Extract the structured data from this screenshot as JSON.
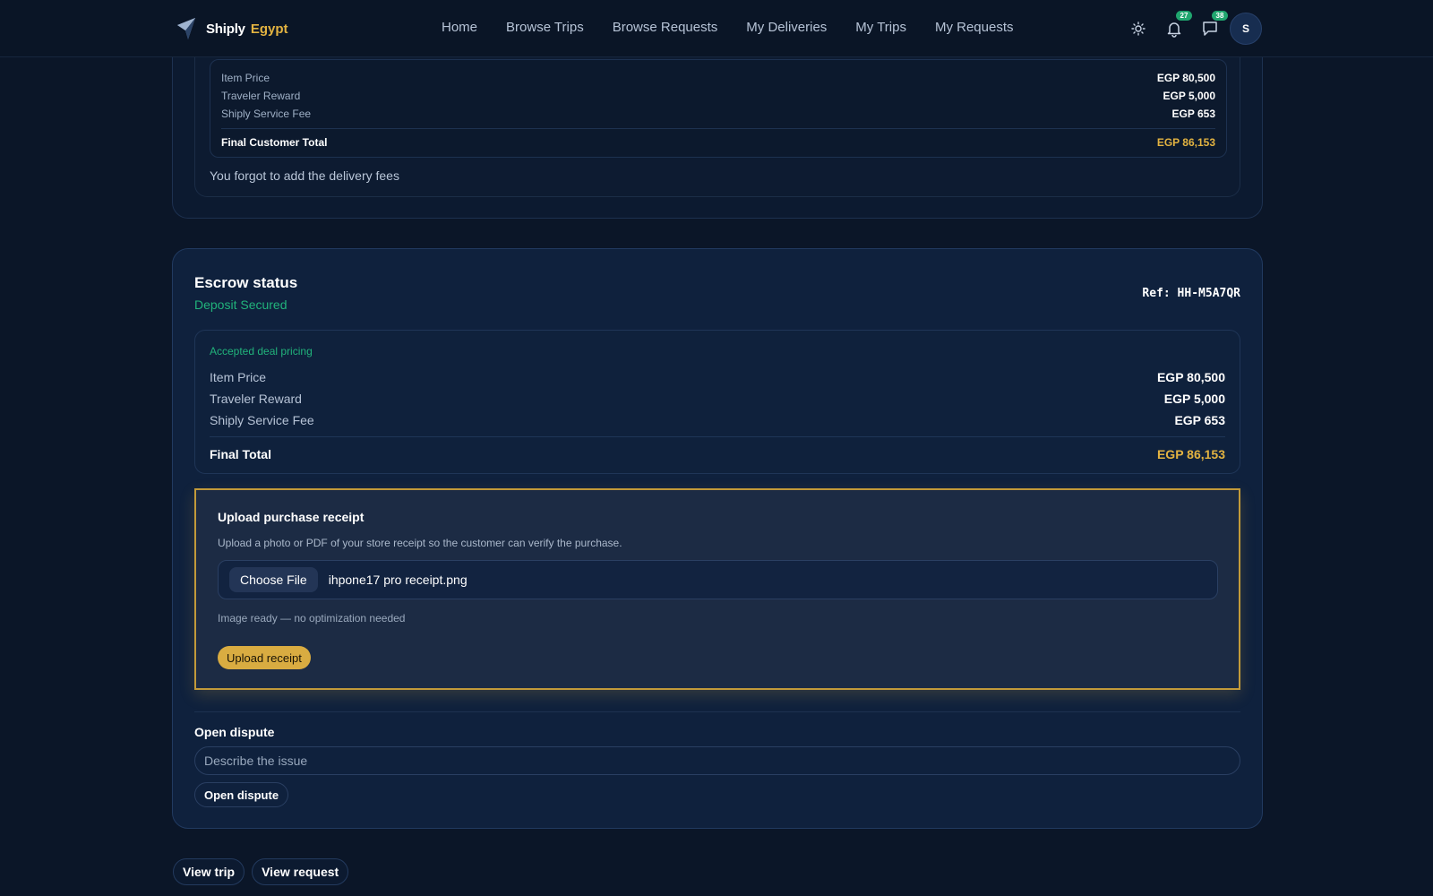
{
  "brand": {
    "name": "Shiply",
    "country": "Egypt"
  },
  "nav": {
    "items": [
      "Home",
      "Browse Trips",
      "Browse Requests",
      "My Deliveries",
      "My Trips",
      "My Requests"
    ]
  },
  "header_right": {
    "theme_icon": "sun-icon",
    "notifications": {
      "icon": "bell-icon",
      "count": "27"
    },
    "messages": {
      "icon": "chat-icon",
      "count": "38"
    },
    "avatar_initial": "S"
  },
  "previous_offer": {
    "rows": [
      {
        "label": "Item Price",
        "value": "EGP 80,500"
      },
      {
        "label": "Traveler Reward",
        "value": "EGP 5,000"
      },
      {
        "label": "Shiply Service Fee",
        "value": "EGP 653"
      }
    ],
    "total": {
      "label": "Final Customer Total",
      "value": "EGP 86,153"
    },
    "note": "You forgot to add the delivery fees"
  },
  "escrow": {
    "title": "Escrow status",
    "status": "Deposit Secured",
    "ref": "Ref: HH-M5A7QR",
    "pricing": {
      "caption": "Accepted deal pricing",
      "rows": [
        {
          "label": "Item Price",
          "value": "EGP 80,500"
        },
        {
          "label": "Traveler Reward",
          "value": "EGP 5,000"
        },
        {
          "label": "Shiply Service Fee",
          "value": "EGP 653"
        }
      ],
      "total": {
        "label": "Final Total",
        "value": "EGP 86,153"
      }
    },
    "upload": {
      "title": "Upload purchase receipt",
      "description": "Upload a photo or PDF of your store receipt so the customer can verify the purchase.",
      "choose_label": "Choose File",
      "file_name": "ihpone17 pro receipt.png",
      "ready_text": "Image ready — no optimization needed",
      "button_label": "Upload receipt"
    },
    "dispute": {
      "label": "Open dispute",
      "placeholder": "Describe the issue",
      "button_label": "Open dispute"
    }
  },
  "footer_links": [
    "View trip",
    "View request"
  ],
  "colors": {
    "accent_gold": "#e3b341",
    "accent_green": "#21b37b",
    "background": "#0b1628"
  }
}
